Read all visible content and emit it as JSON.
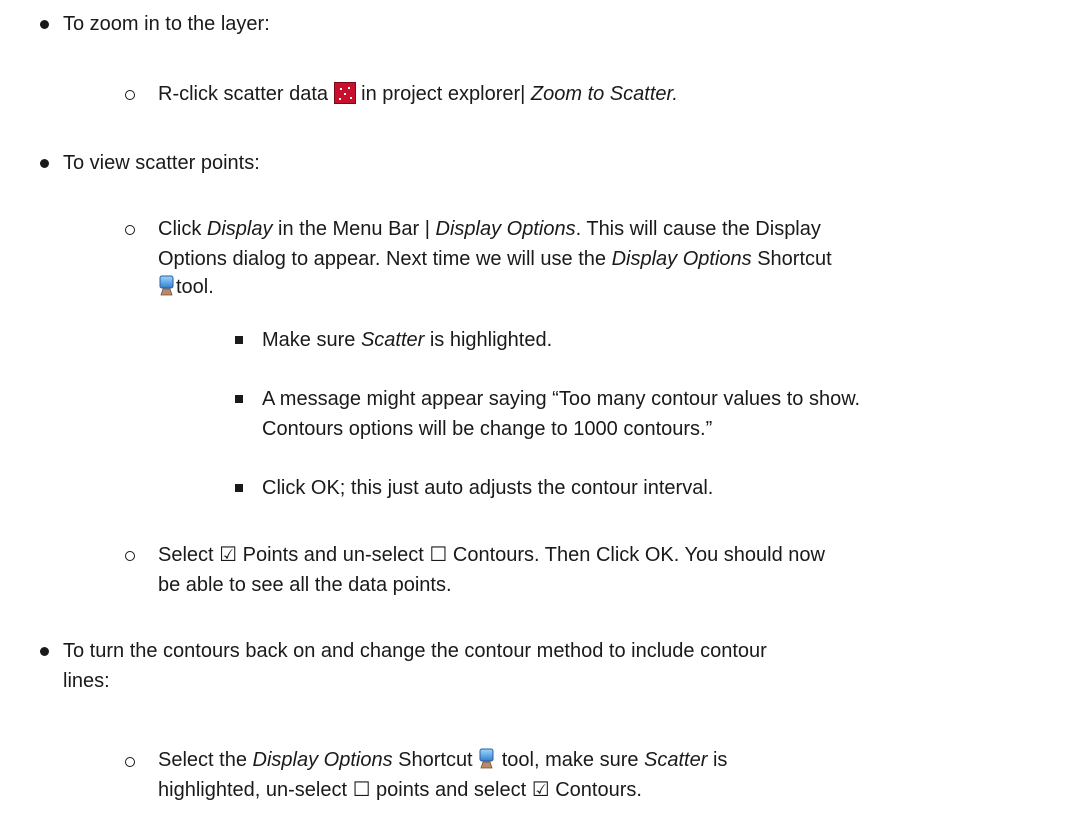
{
  "items": [
    {
      "text": "To zoom in to the layer:"
    },
    {
      "pre": "R-click scatter data ",
      "icon": "scatter-data-icon",
      "mid": " in project explorer| ",
      "em": "Zoom to Scatter."
    },
    {
      "text": "To view scatter points:"
    },
    {
      "l1": "Click ",
      "e1": "Display",
      "l2": " in the Menu Bar | ",
      "e2": "Display Options",
      "l3": ". This will cause the Display",
      "l4": "Options dialog to appear. Next time we will use the ",
      "e3": "Display Options",
      "l5": " Shortcut",
      "icon": "display-options-icon",
      "l6": "tool."
    },
    {
      "pre": "Make sure ",
      "em": "Scatter",
      "post": " is highlighted."
    },
    {
      "line1": "A message might appear saying “Too many contour values to show.",
      "line2": "Contours options will be change to 1000 contours.”"
    },
    {
      "text": "Click OK; this just auto adjusts the contour interval."
    },
    {
      "line1": "Select ☑ Points and un-select ☐ Contours. Then Click OK. You should now",
      "line2": "be able to see all the data points."
    },
    {
      "line1": "To turn the contours back on and change the contour method to include contour",
      "line2": "lines:"
    },
    {
      "pre": "Select the ",
      "em1": "Display Options",
      "mid1": " Shortcut ",
      "icon": "display-options-icon",
      "mid2": " tool, make sure ",
      "em2": "Scatter",
      "post": " is",
      "line2": "highlighted, un-select ☐ points and select ☑ Contours."
    }
  ]
}
